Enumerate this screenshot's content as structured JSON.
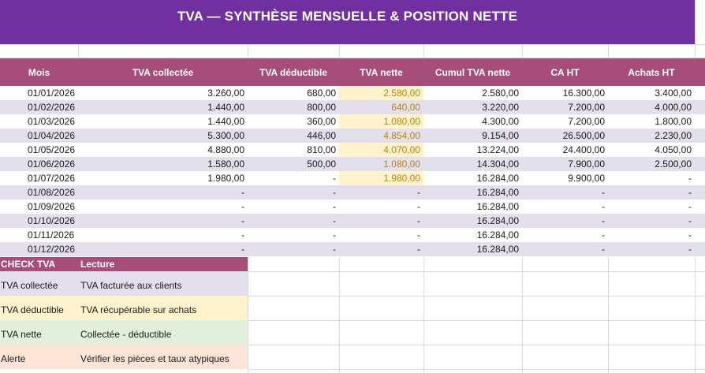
{
  "title": "TVA — SYNTHÈSE MENSUELLE & POSITION NETTE",
  "headers": [
    "Mois",
    "TVA collectée",
    "TVA déductible",
    "TVA nette",
    "Cumul TVA nette",
    "CA HT",
    "Achats HT"
  ],
  "rows": [
    {
      "mois": "01/01/2026",
      "collectee": "3.260,00",
      "deductible": "680,00",
      "nette": "2.580,00",
      "cumul": "2.580,00",
      "ca": "16.300,00",
      "achats": "3.400,00"
    },
    {
      "mois": "01/02/2026",
      "collectee": "1.440,00",
      "deductible": "800,00",
      "nette": "640,00",
      "cumul": "3.220,00",
      "ca": "7.200,00",
      "achats": "4.000,00"
    },
    {
      "mois": "01/03/2026",
      "collectee": "1.440,00",
      "deductible": "360,00",
      "nette": "1.080,00",
      "cumul": "4.300,00",
      "ca": "7.200,00",
      "achats": "1.800,00"
    },
    {
      "mois": "01/04/2026",
      "collectee": "5.300,00",
      "deductible": "446,00",
      "nette": "4.854,00",
      "cumul": "9.154,00",
      "ca": "26.500,00",
      "achats": "2.230,00"
    },
    {
      "mois": "01/05/2026",
      "collectee": "4.880,00",
      "deductible": "810,00",
      "nette": "4.070,00",
      "cumul": "13.224,00",
      "ca": "24.400,00",
      "achats": "4.050,00"
    },
    {
      "mois": "01/06/2026",
      "collectee": "1.580,00",
      "deductible": "500,00",
      "nette": "1.080,00",
      "cumul": "14.304,00",
      "ca": "7.900,00",
      "achats": "2.500,00"
    },
    {
      "mois": "01/07/2026",
      "collectee": "1.980,00",
      "deductible": "-",
      "nette": "1.980,00",
      "cumul": "16.284,00",
      "ca": "9.900,00",
      "achats": "-"
    },
    {
      "mois": "01/08/2026",
      "collectee": "-",
      "deductible": "-",
      "nette": "-",
      "cumul": "16.284,00",
      "ca": "-",
      "achats": "-"
    },
    {
      "mois": "01/09/2026",
      "collectee": "-",
      "deductible": "-",
      "nette": "-",
      "cumul": "16.284,00",
      "ca": "-",
      "achats": "-"
    },
    {
      "mois": "01/10/2026",
      "collectee": "-",
      "deductible": "-",
      "nette": "-",
      "cumul": "16.284,00",
      "ca": "-",
      "achats": "-"
    },
    {
      "mois": "01/11/2026",
      "collectee": "-",
      "deductible": "-",
      "nette": "-",
      "cumul": "16.284,00",
      "ca": "-",
      "achats": "-"
    },
    {
      "mois": "01/12/2026",
      "collectee": "-",
      "deductible": "-",
      "nette": "-",
      "cumul": "16.284,00",
      "ca": "-",
      "achats": "-"
    }
  ],
  "check": {
    "head1": "CHECK TVA",
    "head2": "Lecture",
    "items": [
      {
        "label": "TVA collectée",
        "text": "TVA facturée aux clients"
      },
      {
        "label": "TVA déductible",
        "text": "TVA récupérable sur achats"
      },
      {
        "label": "TVA nette",
        "text": "Collectée - déductible"
      },
      {
        "label": "Alerte",
        "text": "Vérifier les pièces et taux atypiques"
      }
    ]
  },
  "colors": {
    "banner": "#7030a0",
    "header": "#a64d79",
    "stripe": "#e3dfec",
    "net_fill": "#fff2cc",
    "net_text": "#b8860b",
    "green": "#e2efda",
    "peach": "#fce4d6"
  }
}
